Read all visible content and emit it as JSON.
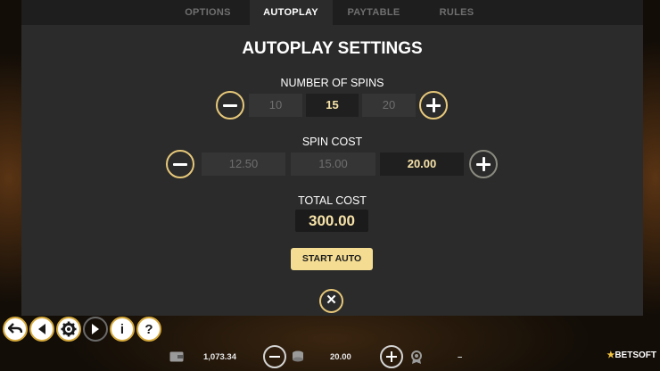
{
  "tabs": [
    {
      "label": "OPTIONS",
      "active": false
    },
    {
      "label": "AUTOPLAY",
      "active": true
    },
    {
      "label": "PAYTABLE",
      "active": false
    },
    {
      "label": "RULES",
      "active": false
    }
  ],
  "title": "AUTOPLAY SETTINGS",
  "spins": {
    "label": "NUMBER OF SPINS",
    "options": [
      "10",
      "15",
      "20"
    ],
    "selected": "15"
  },
  "spin_cost": {
    "label": "SPIN COST",
    "options": [
      "12.50",
      "15.00",
      "20.00"
    ],
    "selected": "20.00"
  },
  "total_cost": {
    "label": "TOTAL COST",
    "value": "300.00"
  },
  "start_button": "START AUTO",
  "close_icon": "close-icon",
  "toolbar": {
    "icons": [
      "back-icon",
      "home-icon",
      "settings-icon",
      "play-icon",
      "info-icon",
      "help-icon"
    ],
    "info_glyph": "i",
    "help_glyph": "?"
  },
  "bottom_bar": {
    "balance": "1,073.34",
    "bet": "20.00",
    "win": "–",
    "logo_text": "BETSOFT",
    "logo_mark": "★"
  },
  "colors": {
    "accent_gold": "#e7c87a",
    "selected_text": "#f7e3a9",
    "start_bg": "#f4dd92",
    "panel_bg": "#2b2b2b"
  }
}
